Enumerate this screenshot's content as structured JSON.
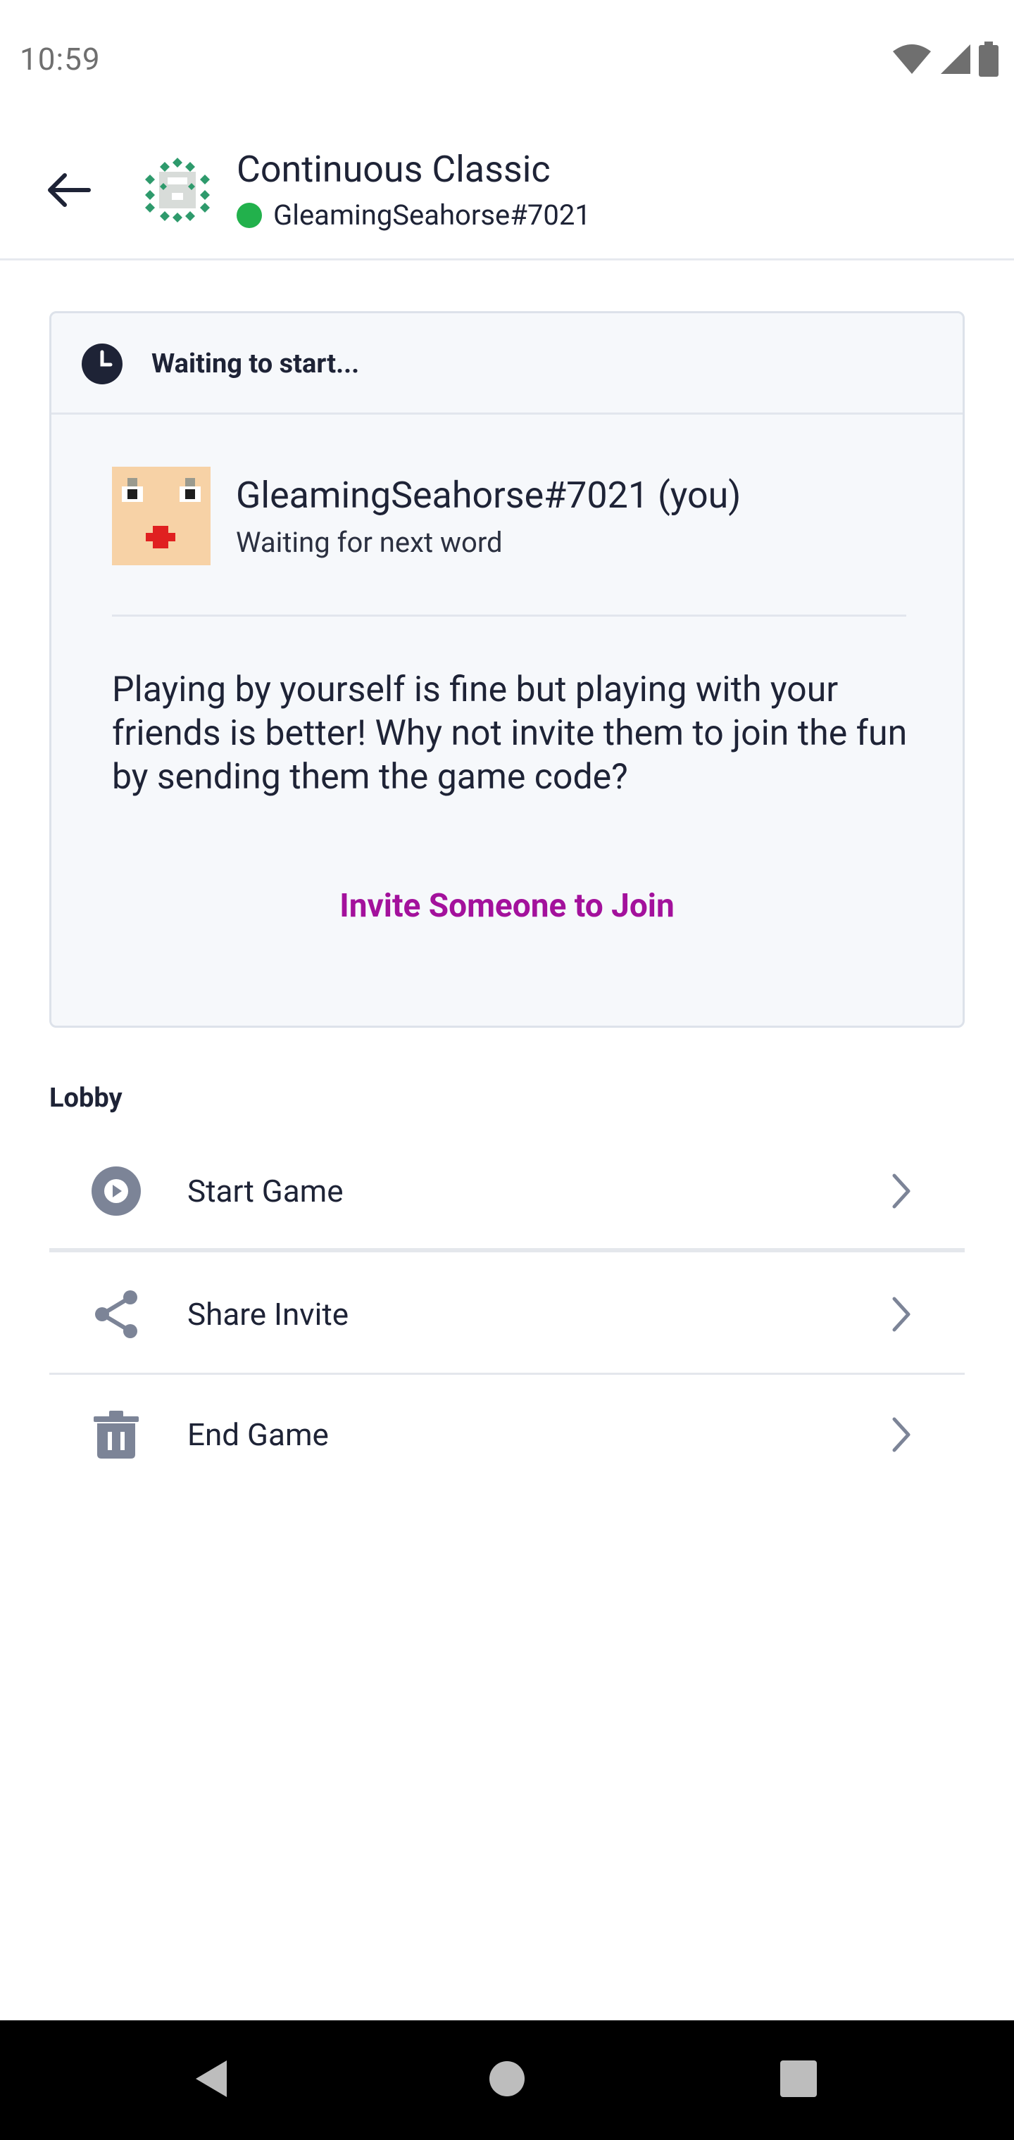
{
  "status_bar": {
    "time": "10:59",
    "icons": [
      "wifi-icon",
      "signal-icon",
      "battery-icon"
    ]
  },
  "header": {
    "back_icon": "arrow-left-icon",
    "title": "Continuous Classic",
    "username": "GleamingSeahorse#7021",
    "online_color": "#22b14c"
  },
  "status_card": {
    "status": "Waiting to start...",
    "player": {
      "name": "GleamingSeahorse#7021 (you)",
      "status": "Waiting for next word"
    },
    "message": "Playing by yourself is fine but playing with your friends is better! Why not invite them to join the fun by sending them the game code?",
    "invite_label": "Invite Someone to Join",
    "accent_color": "#a3119c"
  },
  "lobby": {
    "title": "Lobby",
    "items": [
      {
        "label": "Start Game",
        "icon": "play-icon"
      },
      {
        "label": "Share Invite",
        "icon": "share-icon"
      },
      {
        "label": "End Game",
        "icon": "trash-icon"
      }
    ]
  },
  "nav_bar": {
    "buttons": [
      "back-nav",
      "home-nav",
      "recents-nav"
    ]
  }
}
